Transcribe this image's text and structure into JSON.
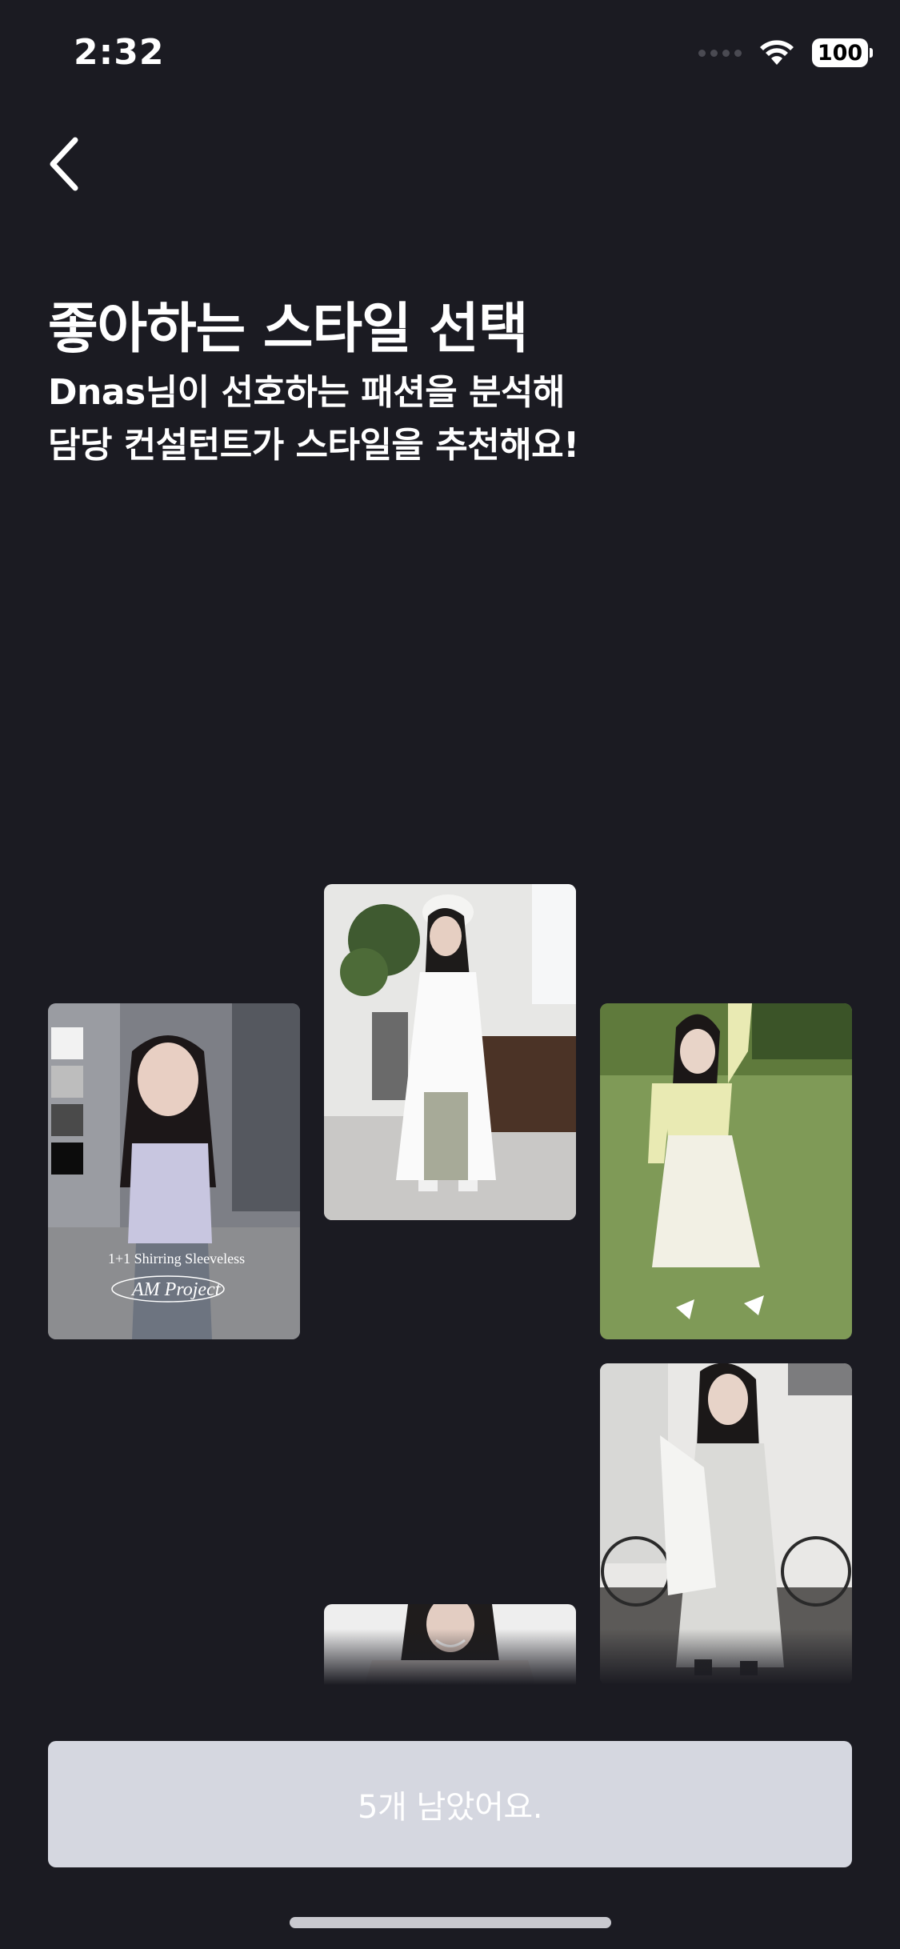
{
  "status_bar": {
    "time": "2:32",
    "battery": "100"
  },
  "header": {
    "title": "좋아하는 스타일 선택",
    "subtitle_line1": "Dnas님이 선호하는 패션을 분석해",
    "subtitle_line2": "담당 컨설턴트가 스타일을 추천해요!"
  },
  "photos": [
    {
      "caption_line1": "1+1 Shirring Sleeveless",
      "caption_line2": "AM Project"
    }
  ],
  "cta": {
    "label": "5개 남았어요."
  },
  "colors": {
    "background": "#1b1b22",
    "button": "#d5d7e0",
    "text": "#ffffff"
  }
}
